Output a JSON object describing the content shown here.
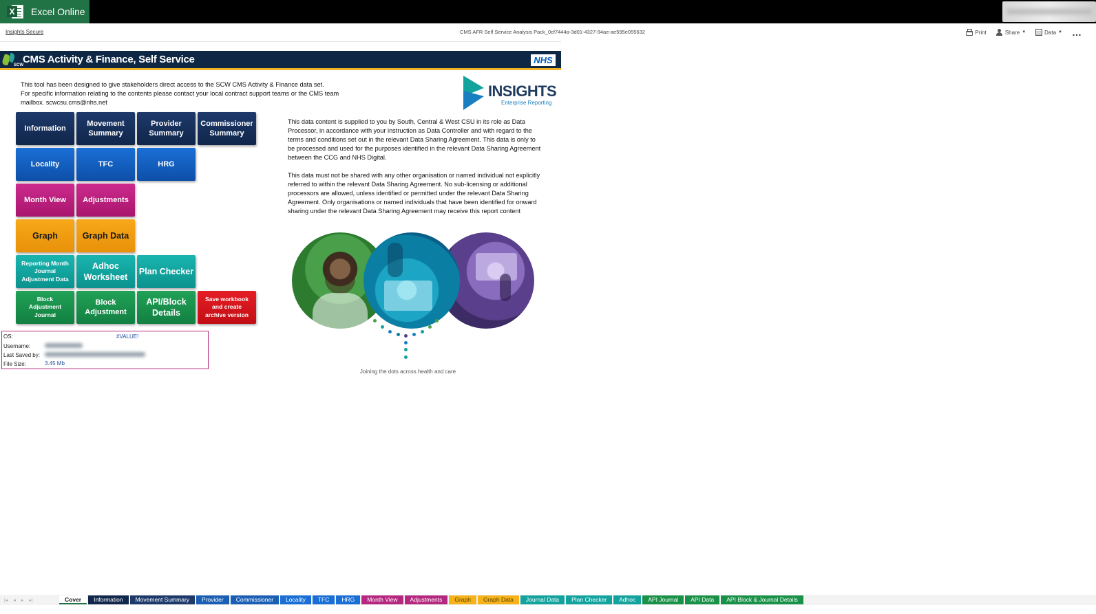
{
  "app": {
    "brand": "Excel Online",
    "breadcrumb": "Insights Secure",
    "document_name": "CMS AFR Self Service Analysis Pack_0cf7444a-3d01-4327-94ae-ae595e055632",
    "toolbar": {
      "print": "Print",
      "share": "Share",
      "data": "Data",
      "more": "…"
    },
    "brand_color": "#217346"
  },
  "banner": {
    "title": "CMS Activity & Finance, Self Service",
    "logo_text": "SCW",
    "nhs": "NHS"
  },
  "intro": {
    "line1": "This tool has been designed to give stakeholders direct access to the SCW CMS Activity & Finance data set.",
    "line2": "For specific information relating to the contents please contact your local contract support teams or the CMS team mailbox. scwcsu.cms@nhs.net"
  },
  "insights_logo": {
    "word": "INSIGHTS",
    "sub": "Enterprise Reporting"
  },
  "nav": {
    "information": "Information",
    "movement_summary": "Movement\nSummary",
    "provider_summary": "Provider\nSummary",
    "commissioner_summary": "Commissioner\nSummary",
    "locality": "Locality",
    "tfc": "TFC",
    "hrg": "HRG",
    "month_view": "Month View",
    "adjustments": "Adjustments",
    "graph": "Graph",
    "graph_data": "Graph Data",
    "reporting_month": "Reporting Month\nJournal\nAdjustment Data",
    "adhoc_worksheet": "Adhoc\nWorksheet",
    "plan_checker": "Plan Checker",
    "block_adjustment_journal": "Block\nAdjustment\nJournal",
    "block_adjustment": "Block\nAdjustment",
    "api_block_details": "API/Block\nDetails",
    "save_workbook": "Save workbook\nand create\narchive version"
  },
  "disclaimer": {
    "p1": "This data content is supplied to you by South, Central & West CSU in its role as Data Processor, in accordance with your instruction as Data Controller and with regard to the terms and conditions set out in the relevant Data Sharing Agreement. This data is only to be processed and used for the purposes identified in the relevant Data Sharing Agreement between the CCG and NHS Digital.",
    "p2": "This data must not be shared with any other organisation or named individual not explicitly referred to within the relevant Data Sharing Agreement. No sub-licensing or additional processors are allowed, unless identified or permitted under the relevant Data Sharing Agreement. Only organisations or named individuals that have been identified for onward sharing under the relevant Data Sharing Agreement may receive this report content"
  },
  "tagline": "Joining the dots across health and care",
  "info_box": {
    "os_label": "OS:",
    "os_value": "#VALUE!",
    "username_label": "Username:",
    "last_saved_label": "Last Saved by:",
    "file_size_label": "File Size:",
    "file_size_value": "3.45 Mb"
  },
  "sheet_tabs": [
    {
      "label": "Cover",
      "color": "#ffffff",
      "active": true
    },
    {
      "label": "Information",
      "color": "#10264a"
    },
    {
      "label": "Movement Summary",
      "color": "#1e3a6b"
    },
    {
      "label": "Provider",
      "color": "#1a5fb4"
    },
    {
      "label": "Commissioner",
      "color": "#1a5fb4"
    },
    {
      "label": "Locality",
      "color": "#1a6fd6"
    },
    {
      "label": "TFC",
      "color": "#1a6fd6"
    },
    {
      "label": "HRG",
      "color": "#1a6fd6"
    },
    {
      "label": "Month View",
      "color": "#b5287f"
    },
    {
      "label": "Adjustments",
      "color": "#b5287f"
    },
    {
      "label": "Graph",
      "color": "#f5b21a"
    },
    {
      "label": "Graph Data",
      "color": "#f5b21a"
    },
    {
      "label": "Journal Data",
      "color": "#13a39e"
    },
    {
      "label": "Plan Checker",
      "color": "#13a39e"
    },
    {
      "label": "Adhoc",
      "color": "#13a39e"
    },
    {
      "label": "API Journal",
      "color": "#1a9148"
    },
    {
      "label": "API Data",
      "color": "#1a9148"
    },
    {
      "label": "API Block & Journal Details",
      "color": "#1a9148"
    }
  ]
}
